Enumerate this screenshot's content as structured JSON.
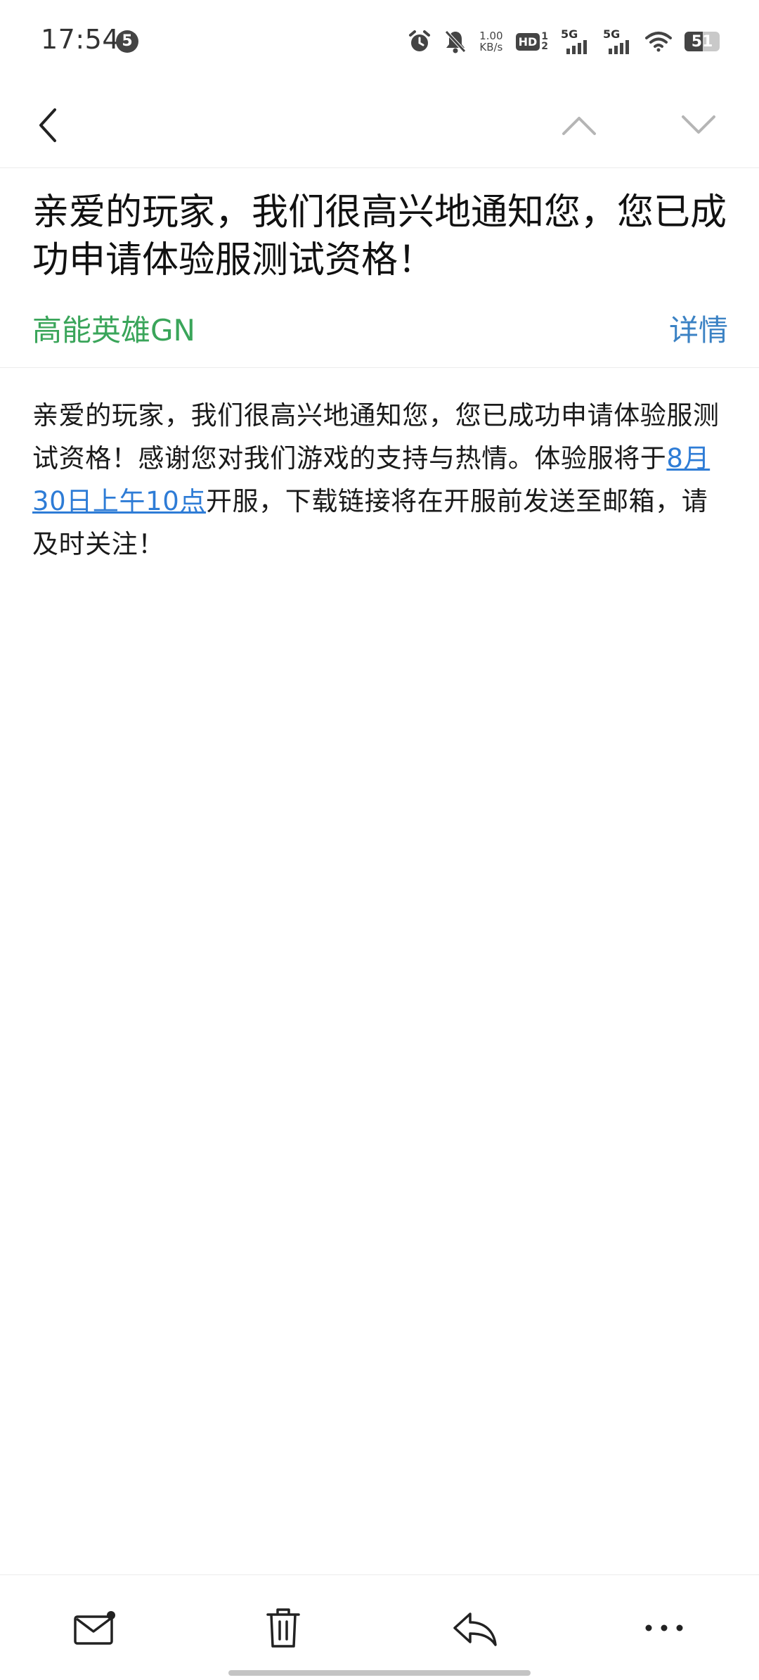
{
  "status_bar": {
    "time": "17:54",
    "notification_count": "5",
    "net_speed_value": "1.00",
    "net_speed_unit": "KB/s",
    "hd_label": "HD",
    "hd_sup": "1",
    "hd_sub": "2",
    "sim1_label": "5G",
    "sim2_label": "5G",
    "battery_level": "51",
    "battery_fraction": 0.51
  },
  "nav": {
    "back_icon": "chevron-left-icon",
    "prev_icon": "chevron-up-icon",
    "next_icon": "chevron-down-icon"
  },
  "email": {
    "subject": "亲爱的玩家，我们很高兴地通知您，您已成功申请体验服测试资格！",
    "sender": "高能英雄GN",
    "details_label": "详情",
    "body_before": "亲爱的玩家，我们很高兴地通知您，您已成功申请体验服测试资格！感谢您对我们游戏的支持与热情。体验服将于",
    "body_link": "8月30日上午10点",
    "body_after": "开服，下载链接将在开服前发送至邮箱，请及时关注！"
  },
  "toolbar": {
    "items": [
      "mail-unread-icon",
      "trash-icon",
      "reply-icon",
      "more-icon"
    ]
  },
  "colors": {
    "sender": "#3aa55a",
    "details_link": "#3b82c4",
    "date_link": "#2e7cd6",
    "icon_gray": "#b5b5b5"
  }
}
